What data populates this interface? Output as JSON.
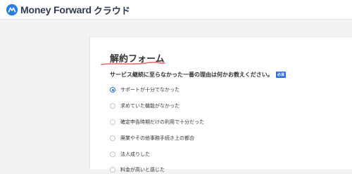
{
  "header": {
    "logo_text": "Money Forward",
    "logo_sub": "クラウド"
  },
  "form": {
    "title": "解約フォーム",
    "question": "サービス継続に至らなかった一番の理由は何かお教えください。",
    "required_badge": "必須",
    "options": [
      {
        "label": "サポートが十分でなかった",
        "checked": true
      },
      {
        "label": "求めていた機能がなかった",
        "checked": false
      },
      {
        "label": "確定申告時期だけの利用で十分だった",
        "checked": false
      },
      {
        "label": "廃業やその他事務手続き上の都合",
        "checked": false
      },
      {
        "label": "法人成りした",
        "checked": false
      },
      {
        "label": "料金が高いと感じた",
        "checked": false
      }
    ]
  },
  "colors": {
    "accent": "#2c6ed5",
    "underline": "#e8686a",
    "logo_blue": "#2a7de1"
  }
}
